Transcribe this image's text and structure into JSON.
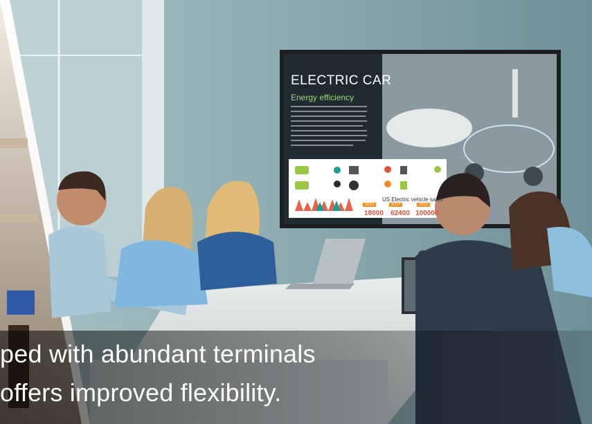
{
  "screen": {
    "title": "ELECTRIC CAR",
    "subtitle": "Energy efficiency",
    "sales_heading": "US Electric vehicle sales",
    "years": [
      "2013",
      "2014",
      "2015"
    ],
    "sales": [
      "18000",
      "62400",
      "100000"
    ]
  },
  "caption": {
    "line1": "ped with abundant terminals",
    "line2": "offers improved flexibility."
  },
  "colors": {
    "wall": "#7f9ea4",
    "screen_bg": "#1f2b30",
    "accent_green": "#9fd67a",
    "accent_orange": "#f28c28"
  }
}
